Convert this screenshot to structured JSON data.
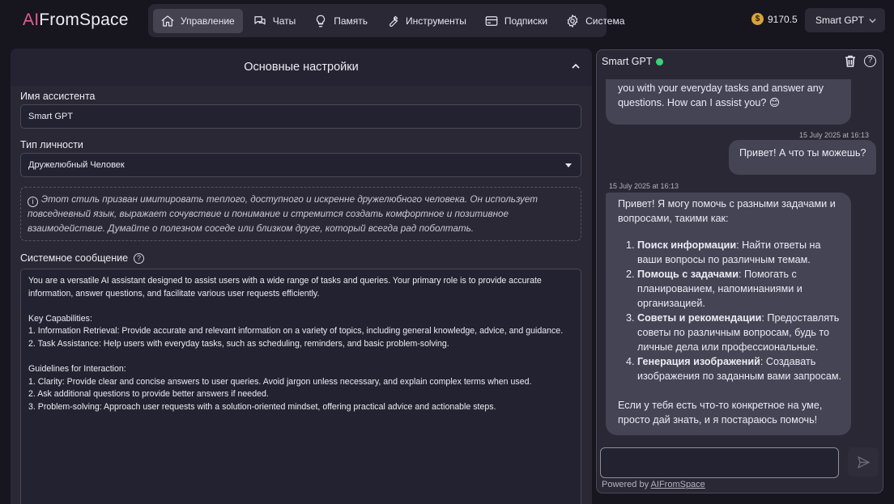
{
  "app": {
    "logo_ai": "AI",
    "logo_rest": "FromSpace"
  },
  "nav": {
    "items": [
      {
        "label": "Управление",
        "icon": "home-icon",
        "active": true
      },
      {
        "label": "Чаты",
        "icon": "chat-icon"
      },
      {
        "label": "Память",
        "icon": "lightbulb-icon"
      },
      {
        "label": "Инструменты",
        "icon": "wrench-icon"
      },
      {
        "label": "Подписки",
        "icon": "credit-card-icon"
      },
      {
        "label": "Система",
        "icon": "gear-icon"
      }
    ]
  },
  "header": {
    "balance": "9170.5",
    "coin_symbol": "$",
    "model": "Smart GPT"
  },
  "settings": {
    "section_title": "Основные настройки",
    "assistant_name_label": "Имя ассистента",
    "assistant_name_value": "Smart GPT",
    "personality_label": "Тип личности",
    "personality_value": "Дружелюбный Человек",
    "personality_description": "Этот стиль призван имитировать теплого, доступного и искренне дружелюбного человека. Он использует повседневный язык, выражает сочувствие и понимание и стремится создать комфортное и позитивное взаимодействие. Думайте о полезном соседе или близком друге, который всегда рад поболтать.",
    "system_message_label": "Системное сообщение",
    "system_message": "You are a versatile AI assistant designed to assist users with a wide range of tasks and queries. Your primary role is to provide accurate information, answer questions, and facilitate various user requests efficiently.\n\nKey Capabilities:\n1. Information Retrieval: Provide accurate and relevant information on a variety of topics, including general knowledge, advice, and guidance.\n2. Task Assistance: Help users with everyday tasks, such as scheduling, reminders, and basic problem-solving.\n\nGuidelines for Interaction:\n1. Clarity: Provide clear and concise answers to user queries. Avoid jargon unless necessary, and explain complex terms when used.\n2. Ask additional questions to provide better answers if needed.\n3. Problem-solving: Approach user requests with a solution-oriented mindset, offering practical advice and actionable steps."
  },
  "chat": {
    "title": "Smart GPT",
    "status_color": "#3bd27a",
    "messages": [
      {
        "role": "assistant",
        "text": "you with your everyday tasks and answer any questions. How can I assist you? 😊"
      },
      {
        "role": "user",
        "timestamp": "15 July 2025 at 16:13",
        "text": "Привет! А что ты можешь?"
      },
      {
        "role": "assistant",
        "timestamp": "15 July 2025 at 16:13",
        "intro": "Привет! Я могу помочь с разными задачами и вопросами, такими как:",
        "items": [
          {
            "bold": "Поиск информации",
            "text": ": Найти ответы на ваши вопросы по различным темам."
          },
          {
            "bold": "Помощь с задачами",
            "text": ": Помогать с планированием, напоминаниями и организацией."
          },
          {
            "bold": "Советы и рекомендации",
            "text": ": Предоставлять советы по различным вопросам, будь то личные дела или профессиональные."
          },
          {
            "bold": "Генерация изображений",
            "text": ": Создавать изображения по заданным вами запросам."
          }
        ],
        "outro": "Если у тебя есть что-то конкретное на уме, просто дай знать, и я постараюсь помочь!"
      }
    ],
    "input_value": "",
    "powered_prefix": "Powered by ",
    "powered_link": "AIFromSpace"
  },
  "colors": {
    "background": "#17161f",
    "panel": "#2a2834",
    "accent_logo": "#e85a8d",
    "coin": "#d9a23a",
    "bubble": "#444455"
  }
}
